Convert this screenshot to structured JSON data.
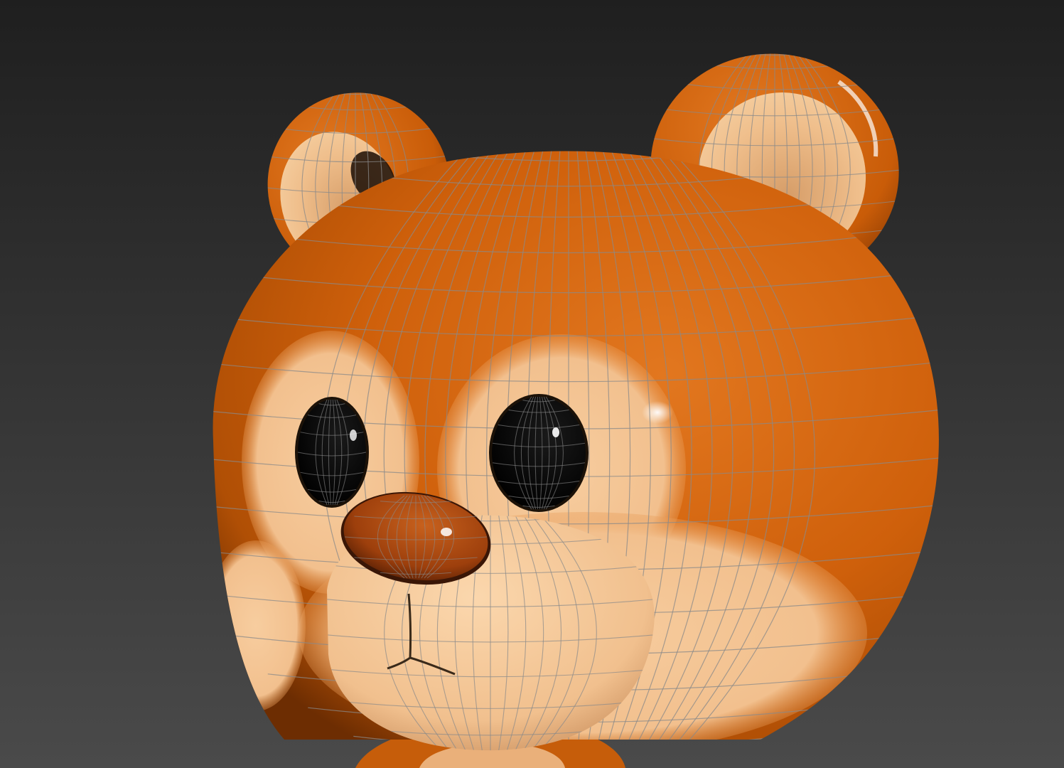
{
  "viewport": {
    "mode": "3d-perspective",
    "shading": "smooth-highlights-with-wireframe",
    "background_top": "#1f1f1f",
    "background_bottom": "#4a4a4a"
  },
  "model": {
    "subject": "cartoon-bear-head",
    "colors": {
      "fur": "#d2620a",
      "fur_dark": "#8e3e04",
      "fur_light": "#e98a2e",
      "muzzle": "#f5c795",
      "muzzle_shadow": "#d9a06d",
      "inner_ear": "#f0bf8c",
      "eye": "#050505",
      "nose": "#a8460e",
      "wireframe": "#8a8a8a"
    }
  }
}
